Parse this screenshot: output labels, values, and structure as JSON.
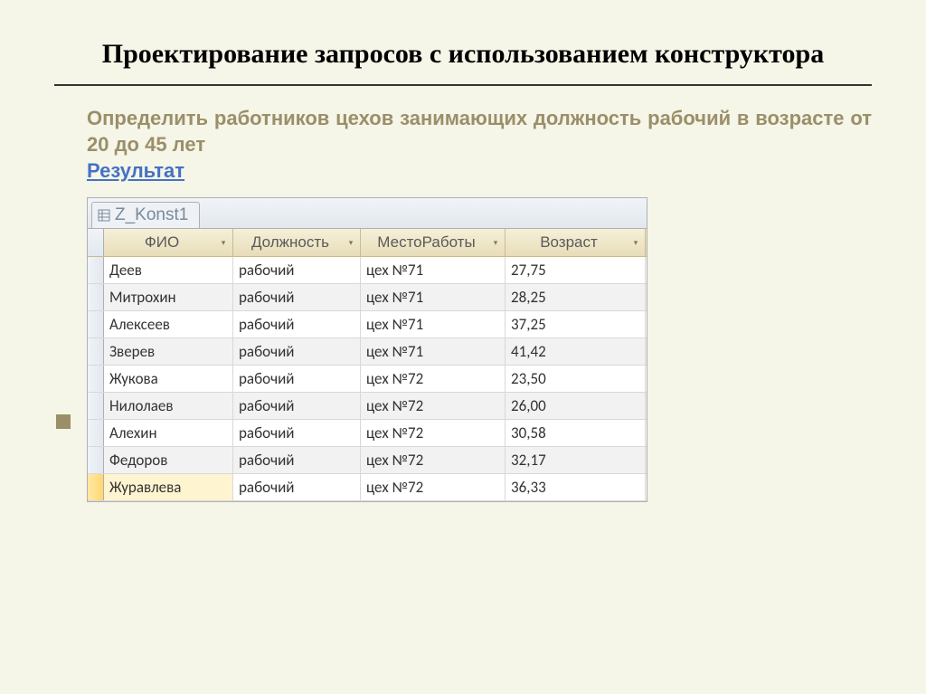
{
  "title": "Проектирование запросов с использованием конструктора",
  "task": "Определить работников цехов занимающих должность рабочий в возрасте от 20 до 45 лет",
  "result_label": "Результат",
  "tab_name": "Z_Konst1",
  "columns": {
    "fio": "ФИО",
    "position": "Должность",
    "place": "МестоРаботы",
    "age": "Возраст"
  },
  "rows": [
    {
      "fio": "Деев",
      "position": "рабочий",
      "place": "цех №71",
      "age": "27,75"
    },
    {
      "fio": "Митрохин",
      "position": "рабочий",
      "place": "цех №71",
      "age": "28,25"
    },
    {
      "fio": "Алексеев",
      "position": "рабочий",
      "place": "цех №71",
      "age": "37,25"
    },
    {
      "fio": "Зверев",
      "position": "рабочий",
      "place": "цех №71",
      "age": "41,42"
    },
    {
      "fio": "Жукова",
      "position": "рабочий",
      "place": "цех №72",
      "age": "23,50"
    },
    {
      "fio": "Нилолаев",
      "position": "рабочий",
      "place": "цех №72",
      "age": "26,00"
    },
    {
      "fio": "Алехин",
      "position": "рабочий",
      "place": "цех №72",
      "age": "30,58"
    },
    {
      "fio": "Федоров",
      "position": "рабочий",
      "place": "цех №72",
      "age": "32,17"
    },
    {
      "fio": "Журавлева",
      "position": "рабочий",
      "place": "цех №72",
      "age": "36,33"
    }
  ]
}
